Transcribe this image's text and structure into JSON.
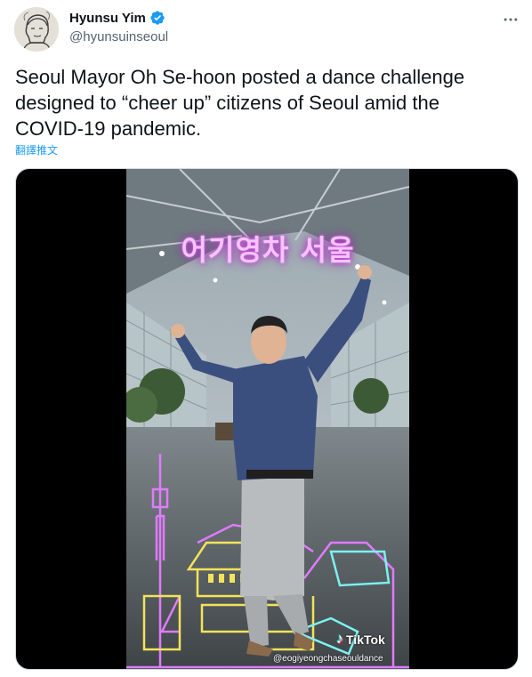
{
  "tweet": {
    "display_name": "Hyunsu Yim",
    "handle": "@hyunsuinseoul",
    "text": "Seoul Mayor Oh Se-hoon posted a dance challenge designed to “cheer up” citizens of Seoul amid the COVID-19 pandemic.",
    "translate_label": "翻譯推文"
  },
  "media": {
    "overlay_title": "어기영차 서울",
    "tiktok_brand": "TikTok",
    "tiktok_handle": "@eogiyeongchaseouldance"
  },
  "icons": {
    "verified": "verified-badge-icon",
    "more": "more-options-icon",
    "tiktok": "tiktok-logo-icon"
  },
  "colors": {
    "accent": "#1d9bf0",
    "text": "#0f1419",
    "secondary_text": "#536471",
    "neon_pink": "#e07bff"
  }
}
